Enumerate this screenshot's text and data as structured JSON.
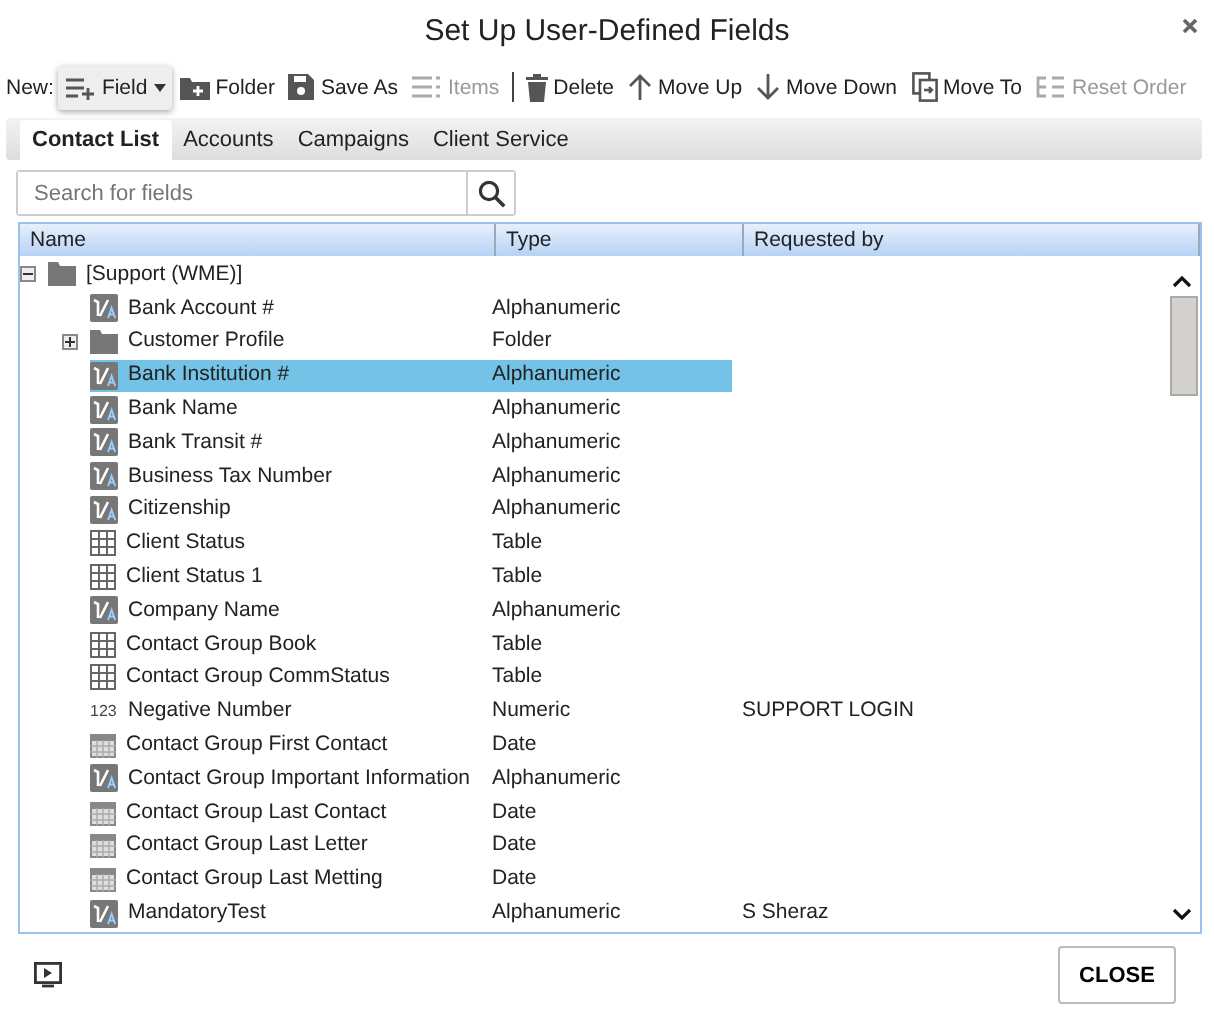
{
  "window": {
    "title": "Set Up User-Defined Fields"
  },
  "toolbar": {
    "new_label": "New:",
    "items": [
      {
        "kind": "field",
        "label": "Field",
        "disabled": false
      },
      {
        "kind": "folder",
        "label": "Folder",
        "disabled": false
      },
      {
        "kind": "save",
        "label": "Save As",
        "disabled": false
      },
      {
        "kind": "items",
        "label": "Items",
        "disabled": true
      },
      {
        "kind": "delete",
        "label": "Delete",
        "disabled": false
      },
      {
        "kind": "up",
        "label": "Move Up",
        "disabled": false
      },
      {
        "kind": "down",
        "label": "Move Down",
        "disabled": false
      },
      {
        "kind": "moveto",
        "label": "Move To",
        "disabled": false
      },
      {
        "kind": "reset",
        "label": "Reset Order",
        "disabled": true
      }
    ]
  },
  "tabs": [
    {
      "label": "Contact List",
      "selected": true
    },
    {
      "label": "Accounts",
      "selected": false
    },
    {
      "label": "Campaigns",
      "selected": false
    },
    {
      "label": "Client Service",
      "selected": false
    }
  ],
  "search": {
    "placeholder": "Search for fields"
  },
  "table": {
    "columns": [
      "Name",
      "Type",
      "Requested by"
    ],
    "rows": [
      {
        "kind": "folder",
        "name": "[Support (WME)]",
        "expanded": true,
        "selected": false,
        "children": [
          {
            "kind": "alpha",
            "name": "Bank Account #",
            "type": "Alphanumeric",
            "selected": false
          },
          {
            "kind": "folder",
            "name": "Customer Profile",
            "type": "Folder",
            "expanded": false,
            "selected": false
          },
          {
            "kind": "alpha",
            "name": "Bank Institution #",
            "type": "Alphanumeric",
            "selected": true
          },
          {
            "kind": "alpha",
            "name": "Bank Name",
            "type": "Alphanumeric",
            "selected": false
          },
          {
            "kind": "alpha",
            "name": "Bank Transit #",
            "type": "Alphanumeric",
            "selected": false
          },
          {
            "kind": "alpha",
            "name": "Business Tax Number",
            "type": "Alphanumeric",
            "selected": false
          },
          {
            "kind": "alpha",
            "name": "Citizenship",
            "type": "Alphanumeric",
            "selected": false
          },
          {
            "kind": "table",
            "name": "Client Status",
            "type": "Table",
            "selected": false
          },
          {
            "kind": "table",
            "name": "Client Status 1",
            "type": "Table",
            "selected": false
          },
          {
            "kind": "alpha",
            "name": "Company Name",
            "type": "Alphanumeric",
            "selected": false
          },
          {
            "kind": "table",
            "name": "Contact Group Book",
            "type": "Table",
            "selected": false
          },
          {
            "kind": "table",
            "name": "Contact Group CommStatus",
            "type": "Table",
            "selected": false
          },
          {
            "kind": "numeric",
            "icon_label": "123",
            "name": "Negative Number",
            "type": "Numeric",
            "requested_by": "SUPPORT LOGIN",
            "selected": false
          },
          {
            "kind": "date",
            "name": "Contact Group First Contact",
            "type": "Date",
            "selected": false
          },
          {
            "kind": "alpha",
            "name": "Contact Group Important Information",
            "type": "Alphanumeric",
            "selected": false
          },
          {
            "kind": "date",
            "name": "Contact Group Last Contact",
            "type": "Date",
            "selected": false
          },
          {
            "kind": "date",
            "name": "Contact Group Last Letter",
            "type": "Date",
            "selected": false
          },
          {
            "kind": "date",
            "name": "Contact Group Last Metting",
            "type": "Date",
            "selected": false
          },
          {
            "kind": "alpha",
            "name": "MandatoryTest",
            "type": "Alphanumeric",
            "requested_by": "S Sheraz",
            "selected": false
          }
        ]
      }
    ]
  },
  "footer": {
    "close_button": "CLOSE"
  }
}
